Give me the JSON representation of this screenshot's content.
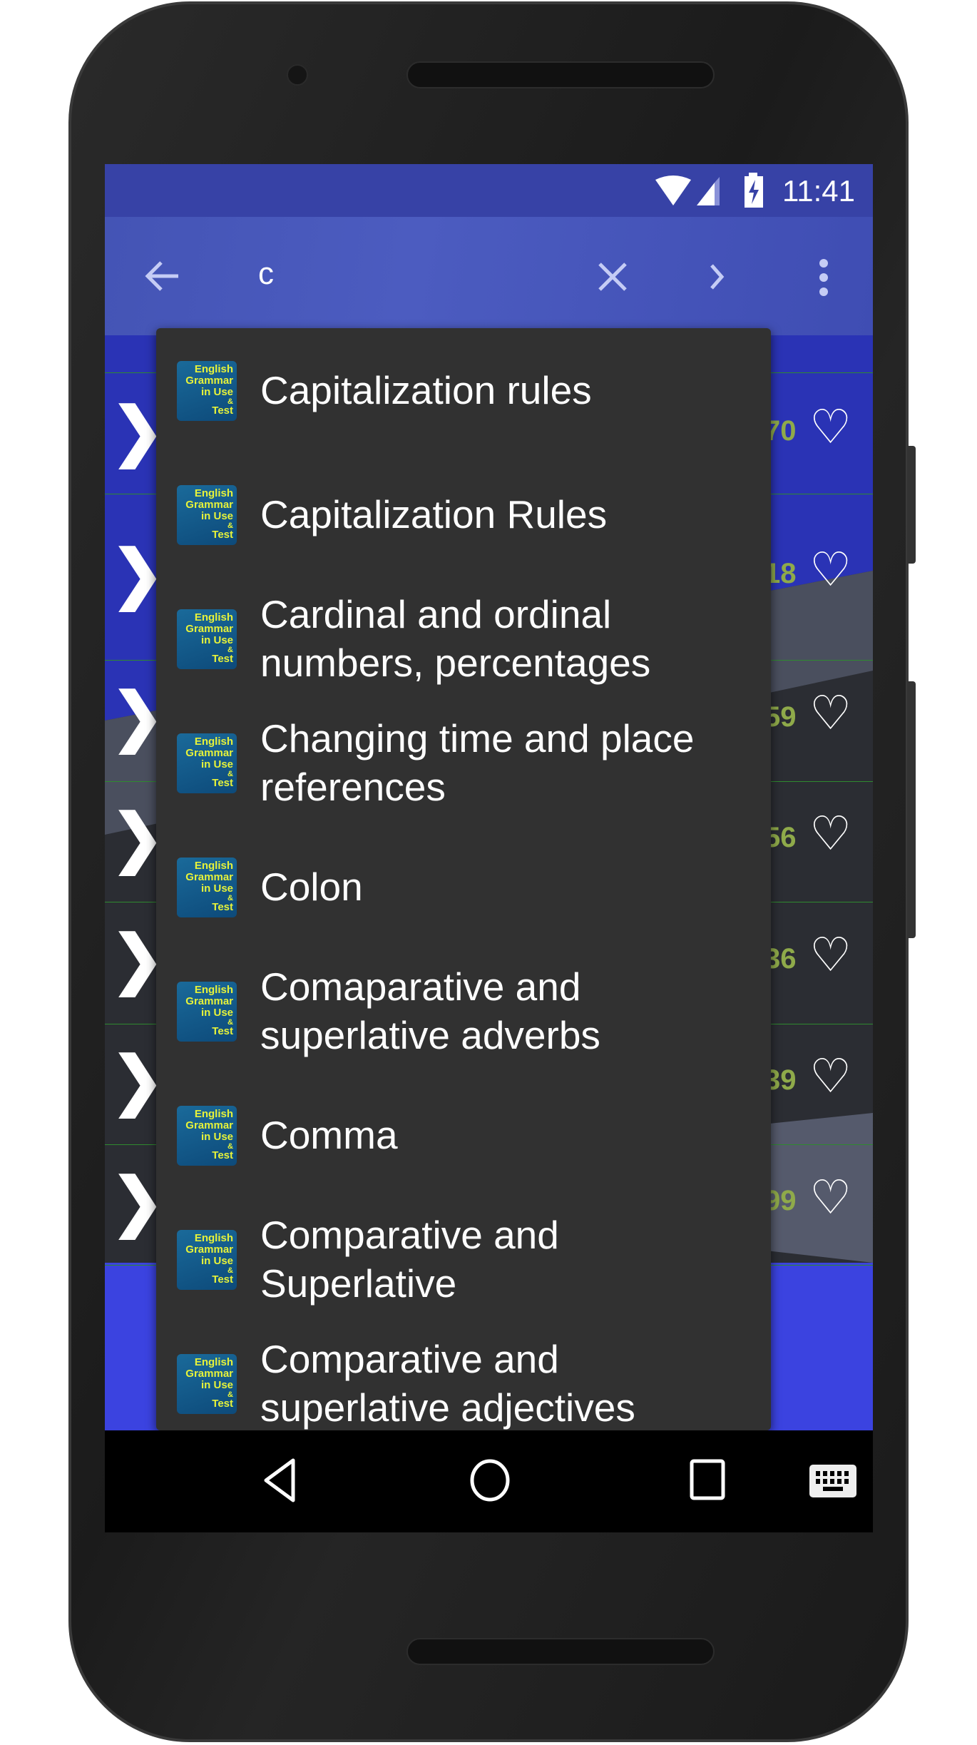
{
  "status": {
    "time": "11:41",
    "icons": [
      "wifi-icon",
      "signal-icon",
      "battery-charging-icon"
    ]
  },
  "toolbar": {
    "query": "c",
    "icons": [
      "back-arrow-icon",
      "clear-icon",
      "forward-icon",
      "overflow-menu-icon"
    ]
  },
  "background_rows": [
    {
      "num": "70"
    },
    {
      "num": "18"
    },
    {
      "num": "59"
    },
    {
      "num": "56"
    },
    {
      "num": "36"
    },
    {
      "num": "39"
    },
    {
      "num": "99"
    }
  ],
  "logo": {
    "line1": "English",
    "line2": "Grammar",
    "line3": "in Use",
    "line4": "&",
    "line5": "Test"
  },
  "suggestions": [
    {
      "label": "Capitalization  rules"
    },
    {
      "label": "Capitalization Rules"
    },
    {
      "label": "Cardinal and ordinal numbers, percentages"
    },
    {
      "label": "Changing time and place references"
    },
    {
      "label": "Colon"
    },
    {
      "label": "Comaparative and superlative adverbs"
    },
    {
      "label": "Comma"
    },
    {
      "label": "Comparative and Superlative"
    },
    {
      "label": "Comparative and superlative adjectives"
    }
  ],
  "navbar": {
    "icons": [
      "back-icon",
      "home-icon",
      "recents-icon",
      "keyboard-icon"
    ]
  },
  "colors": {
    "toolbar": "#4454b5",
    "status": "#3742a6",
    "dropdown": "#313131",
    "count": "#8faa4a",
    "logo_text": "#e6f23a"
  }
}
